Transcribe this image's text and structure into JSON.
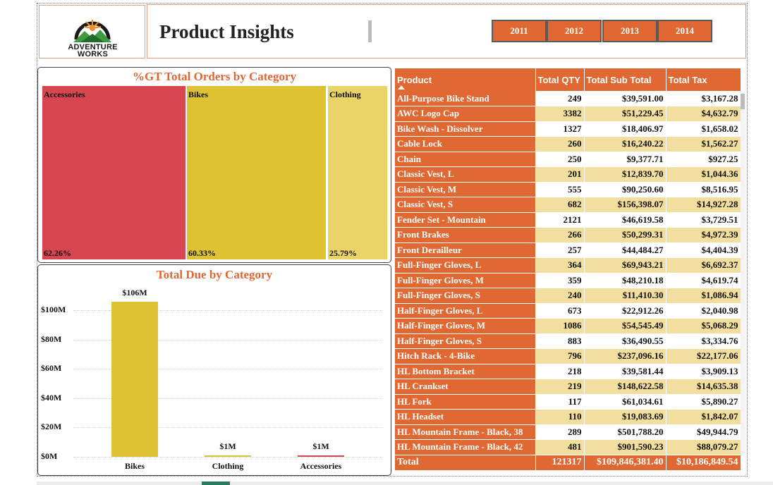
{
  "header": {
    "logo_line1": "ADVENTURE",
    "logo_line2": "WORKS",
    "title": "Product Insights",
    "years": [
      "2011",
      "2012",
      "2013",
      "2014"
    ]
  },
  "treemap": {
    "title": "%GT Total Orders by Category",
    "cells": [
      {
        "name": "Accessories",
        "pct": "62.26%",
        "color": "#d64550"
      },
      {
        "name": "Bikes",
        "pct": "60.33%",
        "color": "#dec232"
      },
      {
        "name": "Clothing",
        "pct": "25.79%",
        "color": "#ead468"
      }
    ]
  },
  "chart_data": {
    "type": "bar",
    "title": "Total Due by Category",
    "categories": [
      "Bikes",
      "Clothing",
      "Accessories"
    ],
    "values": [
      106,
      1,
      1
    ],
    "value_labels": [
      "$106M",
      "$1M",
      "$1M"
    ],
    "colors": [
      "#dec232",
      "#dec232",
      "#d64550"
    ],
    "yticks": [
      "$0M",
      "$20M",
      "$40M",
      "$60M",
      "$80M",
      "$100M"
    ],
    "ylim": [
      0,
      106
    ],
    "grid": true
  },
  "table": {
    "headers": [
      "Product",
      "Total QTY",
      "Total Sub Total",
      "Total Tax"
    ],
    "rows": [
      [
        "All-Purpose Bike Stand",
        "249",
        "$39,591.00",
        "$3,167.28"
      ],
      [
        "AWC Logo Cap",
        "3382",
        "$51,229.45",
        "$4,632.79"
      ],
      [
        "Bike Wash - Dissolver",
        "1327",
        "$18,406.97",
        "$1,658.02"
      ],
      [
        "Cable Lock",
        "260",
        "$16,240.22",
        "$1,562.27"
      ],
      [
        "Chain",
        "250",
        "$9,377.71",
        "$927.25"
      ],
      [
        "Classic Vest, L",
        "201",
        "$12,839.70",
        "$1,044.36"
      ],
      [
        "Classic Vest, M",
        "555",
        "$90,250.60",
        "$8,516.95"
      ],
      [
        "Classic Vest, S",
        "682",
        "$156,398.07",
        "$14,927.28"
      ],
      [
        "Fender Set - Mountain",
        "2121",
        "$46,619.58",
        "$3,729.51"
      ],
      [
        "Front Brakes",
        "266",
        "$50,299.31",
        "$4,972.39"
      ],
      [
        "Front Derailleur",
        "257",
        "$44,484.27",
        "$4,404.39"
      ],
      [
        "Full-Finger Gloves, L",
        "364",
        "$69,943.21",
        "$6,692.37"
      ],
      [
        "Full-Finger Gloves, M",
        "359",
        "$48,210.18",
        "$4,619.74"
      ],
      [
        "Full-Finger Gloves, S",
        "240",
        "$11,410.30",
        "$1,086.94"
      ],
      [
        "Half-Finger Gloves, L",
        "673",
        "$22,912.26",
        "$2,040.98"
      ],
      [
        "Half-Finger Gloves, M",
        "1086",
        "$54,545.49",
        "$5,068.29"
      ],
      [
        "Half-Finger Gloves, S",
        "883",
        "$36,490.55",
        "$3,334.76"
      ],
      [
        "Hitch Rack - 4-Bike",
        "796",
        "$237,096.16",
        "$22,177.06"
      ],
      [
        "HL Bottom Bracket",
        "218",
        "$39,581.44",
        "$3,909.13"
      ],
      [
        "HL Crankset",
        "219",
        "$148,622.58",
        "$14,635.38"
      ],
      [
        "HL Fork",
        "117",
        "$61,034.61",
        "$5,890.27"
      ],
      [
        "HL Headset",
        "110",
        "$19,083.69",
        "$1,842.07"
      ],
      [
        "HL Mountain Frame - Black, 38",
        "289",
        "$501,788.20",
        "$49,944.79"
      ],
      [
        "HL Mountain Frame - Black, 42",
        "481",
        "$901,590.23",
        "$88,079.27"
      ]
    ],
    "total": [
      "Total",
      "121317",
      "$109,846,381.40",
      "$10,186,849.54"
    ]
  }
}
